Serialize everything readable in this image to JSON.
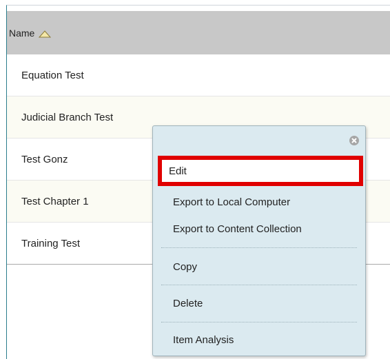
{
  "table": {
    "header": {
      "name_label": "Name"
    },
    "rows": [
      {
        "name": "Equation Test"
      },
      {
        "name": "Judicial Branch Test"
      },
      {
        "name": "Test Gonz"
      },
      {
        "name": "Test Chapter 1"
      },
      {
        "name": "Training Test"
      }
    ]
  },
  "context_menu": {
    "items": [
      {
        "label": "Edit"
      },
      {
        "label": "Export to Local Computer"
      },
      {
        "label": "Export to Content Collection"
      },
      {
        "label": "Copy"
      },
      {
        "label": "Delete"
      },
      {
        "label": "Item Analysis"
      }
    ],
    "highlight_color": "#e00000",
    "background_color": "#dbeaf0"
  },
  "icons": {
    "sort": "sort-ascending-triangle-icon",
    "close": "close-circle-icon"
  }
}
